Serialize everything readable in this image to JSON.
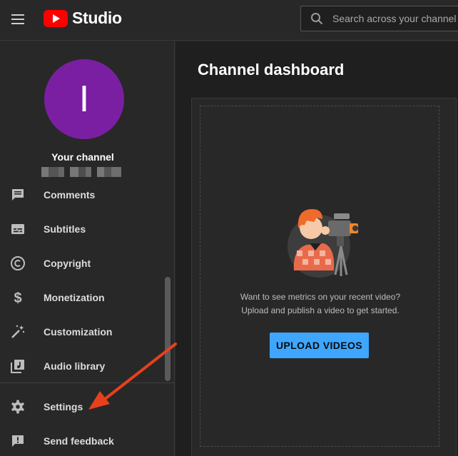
{
  "header": {
    "logo_text": "Studio",
    "search_placeholder": "Search across your channel"
  },
  "sidebar": {
    "avatar_letter": "I",
    "channel_label": "Your channel",
    "items": [
      {
        "label": "Comments",
        "icon": "comment-icon"
      },
      {
        "label": "Subtitles",
        "icon": "subtitles-icon"
      },
      {
        "label": "Copyright",
        "icon": "copyright-icon"
      },
      {
        "label": "Monetization",
        "icon": "dollar-icon"
      },
      {
        "label": "Customization",
        "icon": "magic-wand-icon"
      },
      {
        "label": "Audio library",
        "icon": "audio-library-icon"
      },
      {
        "label": "Settings",
        "icon": "gear-icon"
      },
      {
        "label": "Send feedback",
        "icon": "feedback-icon"
      }
    ]
  },
  "main": {
    "title": "Channel dashboard",
    "card": {
      "message_line1": "Want to see metrics on your recent video?",
      "message_line2": "Upload and publish a video to get started.",
      "upload_label": "UPLOAD VIDEOS"
    }
  },
  "colors": {
    "accent": "#3ea6ff",
    "brand_red": "#ff0000",
    "avatar": "#7b1fa2",
    "annotation_arrow": "#e8401c"
  }
}
